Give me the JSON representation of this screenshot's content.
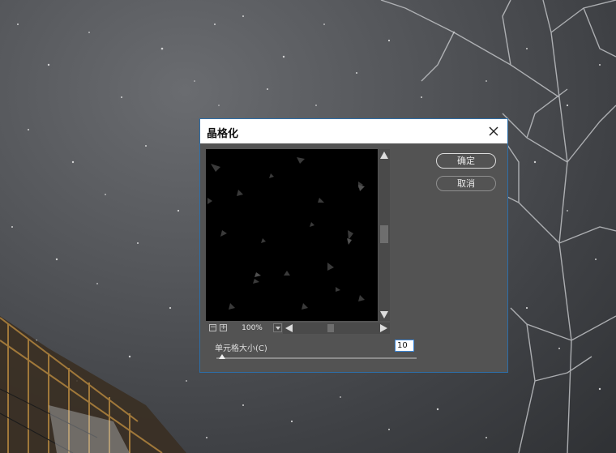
{
  "dialog": {
    "title": "晶格化",
    "close_icon": "close-icon",
    "ok_label": "确定",
    "cancel_label": "取消",
    "zoom_value": "100%",
    "zoom_out_symbol": "−",
    "zoom_in_symbol": "+",
    "param_label": "单元格大小(C)",
    "param_value": "10",
    "param_slider_fraction": 0.03
  },
  "colors": {
    "dialog_bg": "#535353",
    "title_bg": "#ffffff",
    "focus_border": "#3a86d8"
  }
}
